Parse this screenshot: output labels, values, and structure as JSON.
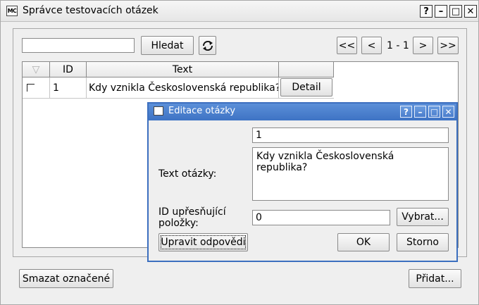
{
  "main_window": {
    "app_icon": "MC",
    "title": "Správce testovacích otázek",
    "help_label": "?",
    "minimize_label": "–",
    "maximize_label": "□",
    "close_label": "✕"
  },
  "toolbar": {
    "search_value": "",
    "search_button": "Hledat",
    "refresh_icon": "refresh-icon",
    "first_label": "<<",
    "prev_label": "<",
    "page_indicator": "1 - 1",
    "next_label": ">",
    "last_label": ">>"
  },
  "table": {
    "sort_icon": "▽",
    "columns": [
      "ID",
      "Text",
      ""
    ],
    "rows": [
      {
        "selected": false,
        "id": "1",
        "text": "Kdy vznikla Československá republika?",
        "detail_label": "Detail"
      }
    ]
  },
  "footer": {
    "delete_selected": "Smazat označené",
    "add": "Přidat..."
  },
  "dialog": {
    "app_icon": "MC",
    "title": "Editace otázky",
    "help_label": "?",
    "minimize_label": "–",
    "maximize_label": "□",
    "close_label": "✕",
    "id_value": "1",
    "question_label": "Text otázky:",
    "question_value": "Kdy vznikla Československá republika?",
    "ref_id_label_line1": "ID upřesňující",
    "ref_id_label_line2": "položky:",
    "ref_id_value": "0",
    "select_button": "Vybrat...",
    "edit_answers_button": "Upravit odpovědi",
    "ok_button": "OK",
    "cancel_button": "Storno"
  },
  "colors": {
    "dialog_title_bar": "#3e73c4",
    "window_background": "#efefef"
  }
}
